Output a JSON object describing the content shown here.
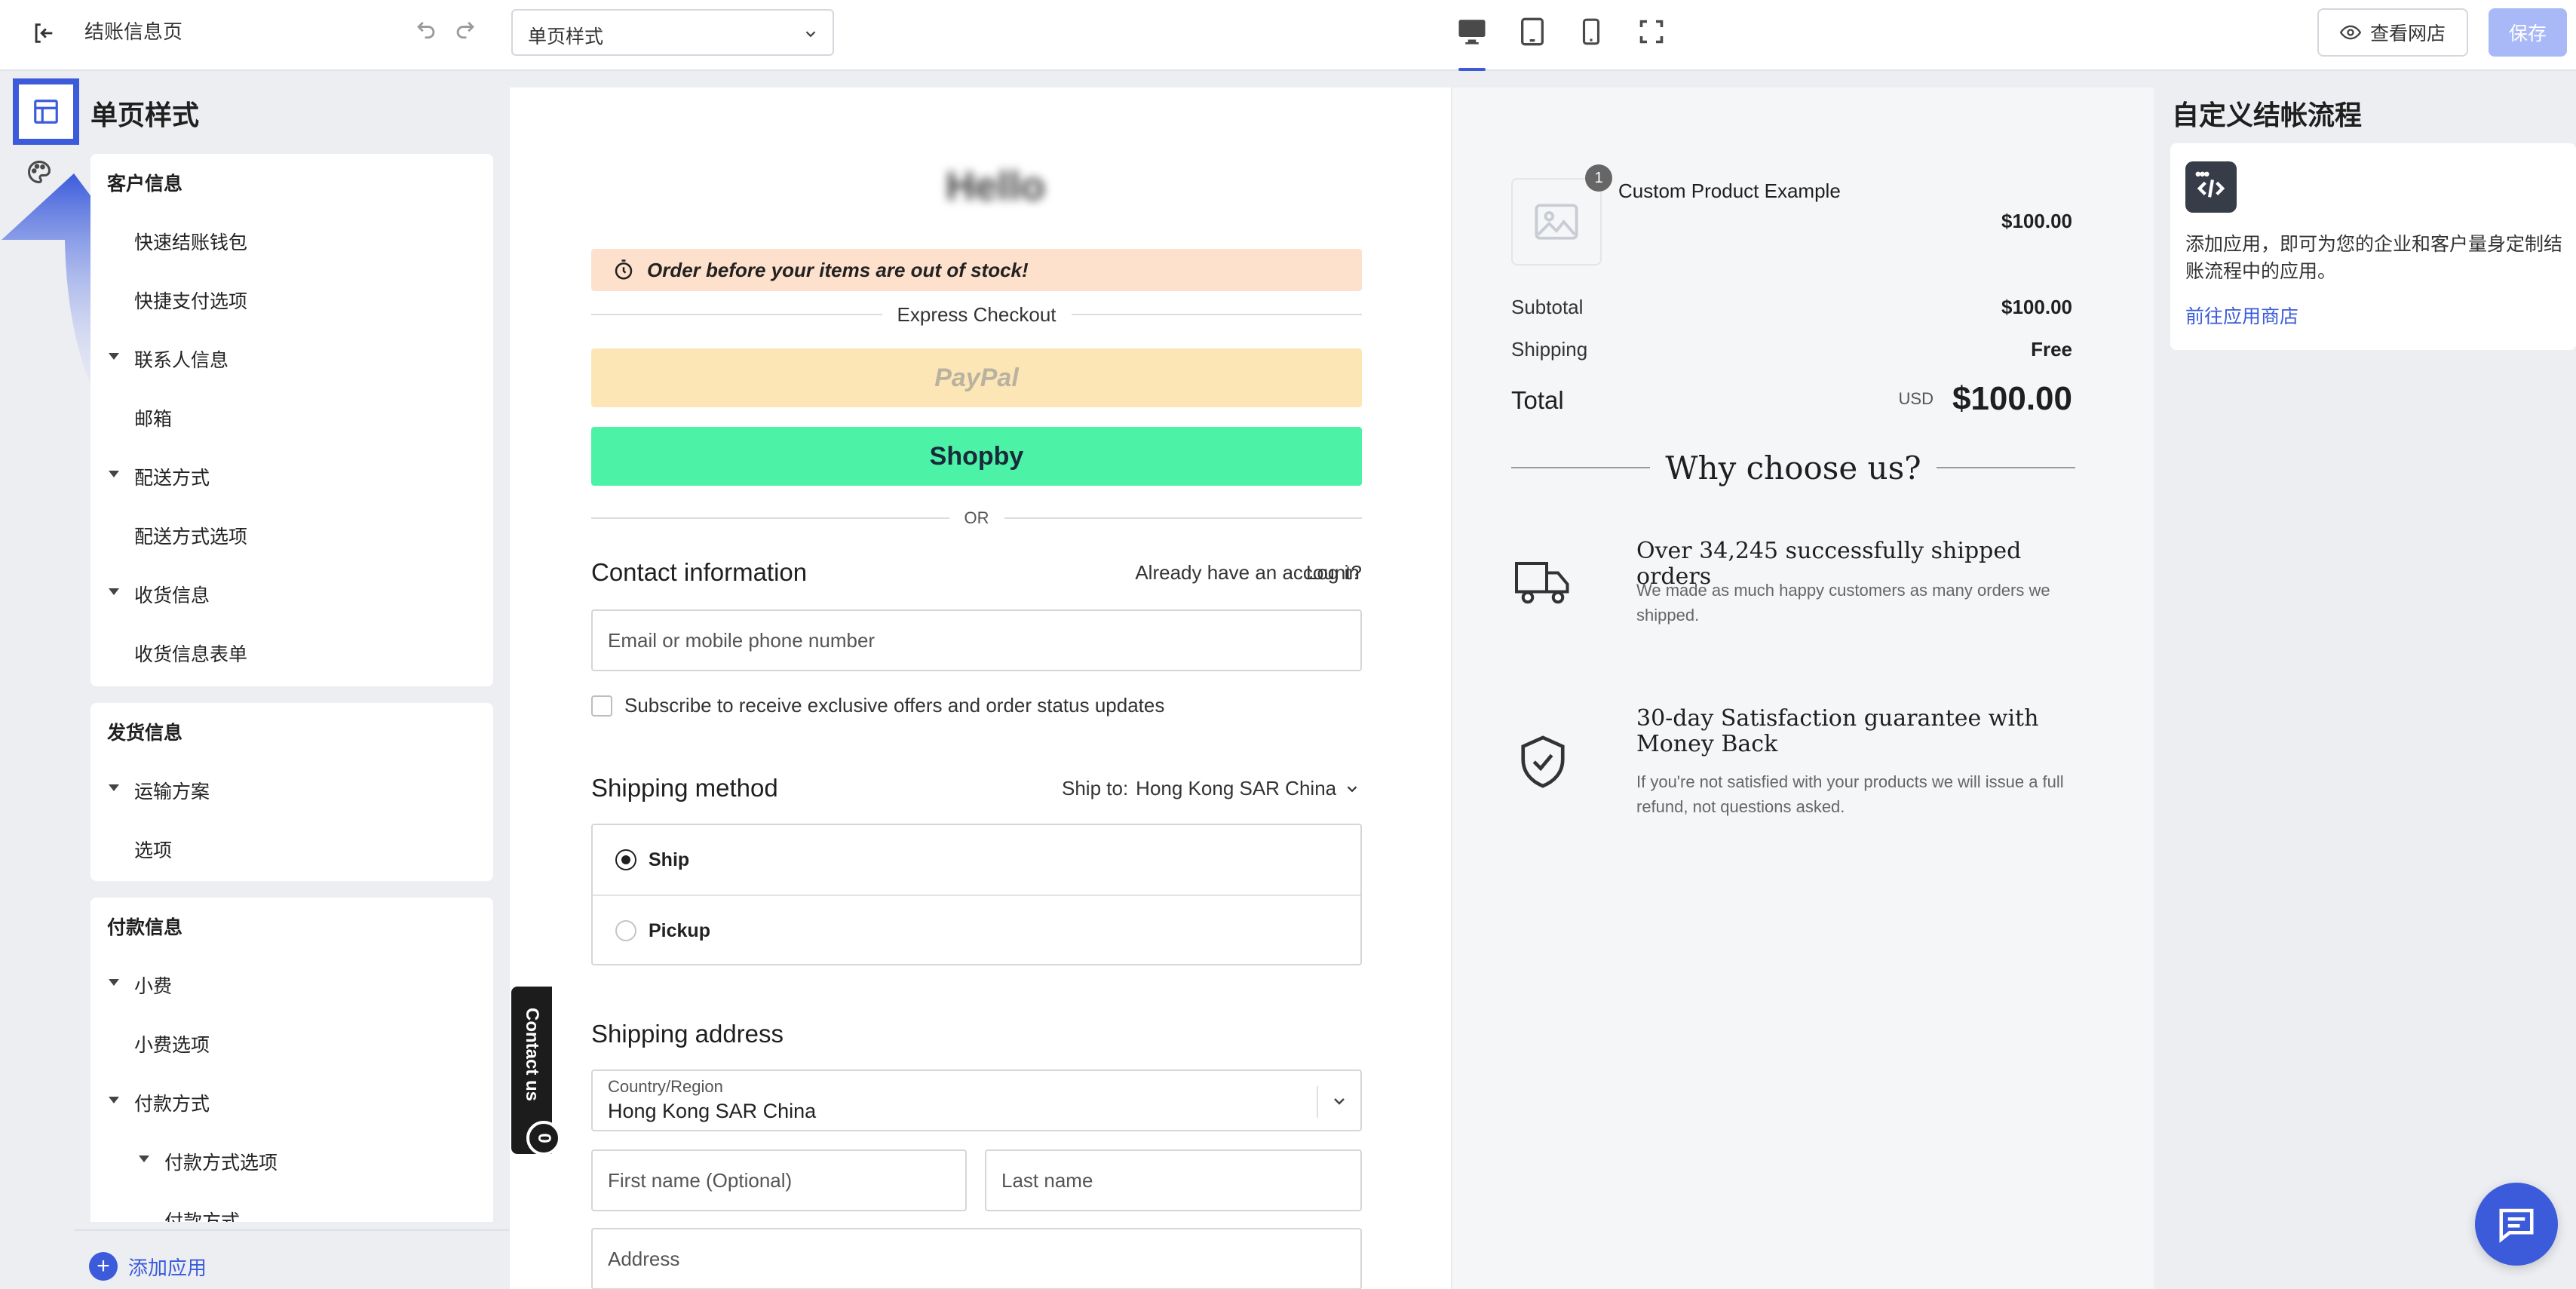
{
  "topbar": {
    "page_name": "结账信息页",
    "template_select": "单页样式",
    "view_store_label": "查看网店",
    "save_label": "保存"
  },
  "left_panel": {
    "title": "单页样式",
    "groups": [
      {
        "heading": "客户信息",
        "items": [
          {
            "label": "快速结账钱包",
            "level": 1,
            "expandable": false
          },
          {
            "label": "快捷支付选项",
            "level": 1,
            "expandable": false
          },
          {
            "label": "联系人信息",
            "level": 1,
            "expandable": true
          },
          {
            "label": "邮箱",
            "level": 1,
            "expandable": false
          },
          {
            "label": "配送方式",
            "level": 1,
            "expandable": true
          },
          {
            "label": "配送方式选项",
            "level": 1,
            "expandable": false
          },
          {
            "label": "收货信息",
            "level": 1,
            "expandable": true
          },
          {
            "label": "收货信息表单",
            "level": 1,
            "expandable": false
          }
        ]
      },
      {
        "heading": "发货信息",
        "items": [
          {
            "label": "运输方案",
            "level": 1,
            "expandable": true
          },
          {
            "label": "选项",
            "level": 1,
            "expandable": false
          }
        ]
      },
      {
        "heading": "付款信息",
        "items": [
          {
            "label": "小费",
            "level": 1,
            "expandable": true
          },
          {
            "label": "小费选项",
            "level": 1,
            "expandable": false
          },
          {
            "label": "付款方式",
            "level": 1,
            "expandable": true
          },
          {
            "label": "付款方式选项",
            "level": 2,
            "expandable": true
          },
          {
            "label": "付款方式",
            "level": 2,
            "expandable": false
          }
        ]
      }
    ],
    "add_app_label": "添加应用"
  },
  "preview": {
    "logo_text": "Hello",
    "stock_banner": "Order before your items are out of stock!",
    "express_checkout": "Express Checkout",
    "paypal_label": "PayPal",
    "shopby_label": "Shopby",
    "or_label": "OR",
    "contact_title": "Contact information",
    "have_account": "Already have an account?",
    "login_link": "Log in",
    "email_placeholder": "Email or mobile phone number",
    "subscribe_label": "Subscribe to receive exclusive offers and order status updates",
    "shipping_method_title": "Shipping method",
    "ship_to_label": "Ship to:",
    "ship_to_value": "Hong Kong SAR China",
    "option_ship": "Ship",
    "option_pickup": "Pickup",
    "shipping_address_title": "Shipping address",
    "country_label": "Country/Region",
    "country_value": "Hong Kong SAR China",
    "first_name_placeholder": "First name (Optional)",
    "last_name_placeholder": "Last name",
    "address_placeholder": "Address",
    "contact_us": "Contact us",
    "contact_badge": "0",
    "summary": {
      "product_qty": "1",
      "product_name": "Custom Product Example",
      "product_price": "$100.00",
      "subtotal_label": "Subtotal",
      "subtotal_value": "$100.00",
      "shipping_label": "Shipping",
      "shipping_value": "Free",
      "total_label": "Total",
      "total_currency": "USD",
      "total_value": "$100.00",
      "why_title": "Why choose us?",
      "features": [
        {
          "icon": "truck-icon",
          "title": "Over 34,245 successfully shipped orders",
          "desc": "We made as much happy customers as many orders we shipped."
        },
        {
          "icon": "shield-check-icon",
          "title": "30-day Satisfaction guarantee with Money Back",
          "desc": "If you're not satisfied with your products we will issue a full refund, not questions asked."
        }
      ]
    }
  },
  "right_panel": {
    "title": "自定义结帐流程",
    "card_desc": "添加应用，即可为您的企业和客户量身定制结账流程中的应用。",
    "card_link": "前往应用商店"
  },
  "colors": {
    "accent": "#3b5bdb",
    "save_disabled": "#a9b8f7",
    "banner": "#fde1cc",
    "paypal": "#fde6b5",
    "shopby": "#4cf2a6"
  }
}
